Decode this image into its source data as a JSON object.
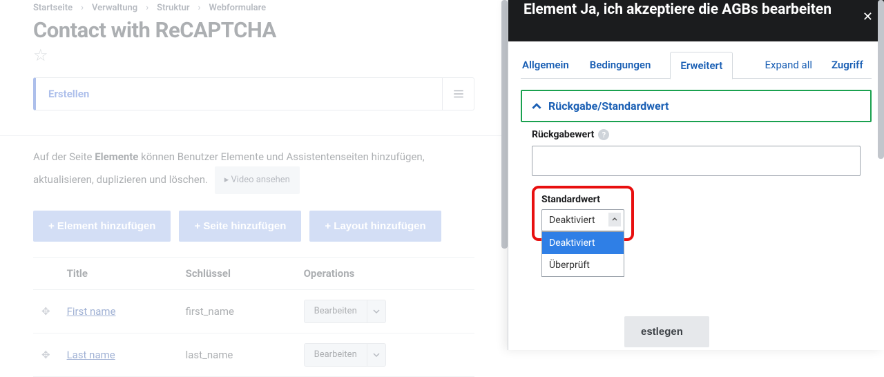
{
  "breadcrumb": {
    "items": [
      "Startseite",
      "Verwaltung",
      "Struktur",
      "Webformulare"
    ]
  },
  "page": {
    "title": "Contact with ReCAPTCHA"
  },
  "local_tasks": {
    "create": "Erstellen"
  },
  "helper": {
    "pre": "Auf der Seite ",
    "bold": "Elemente",
    "post": " können Benutzer Elemente und Assistentenseiten hinzufügen, aktualisieren, duplizieren und löschen.",
    "video_btn": "▸ Video ansehen"
  },
  "add_buttons": {
    "element": "+ Element hinzufügen",
    "page": "+ Seite hinzufügen",
    "layout": "+ Layout hinzufügen"
  },
  "table": {
    "headers": {
      "title": "Title",
      "key": "Schlüssel",
      "ops": "Operations"
    },
    "rows": [
      {
        "title": "First name",
        "key": "first_name",
        "op": "Bearbeiten"
      },
      {
        "title": "Last name",
        "key": "last_name",
        "op": "Bearbeiten"
      }
    ]
  },
  "modal": {
    "title": "Element Ja, ich akzeptiere die AGBs bearbeiten",
    "tabs": {
      "general": "Allgemein",
      "conditions": "Bedingungen",
      "advanced": "Erweitert",
      "access": "Zugriff"
    },
    "expand_all": "Expand all",
    "fieldset_title": "Rückgabe/Standardwert",
    "return_label": "Rückgabewert",
    "default_label": "Standardwert",
    "select": {
      "selected": "Deaktiviert",
      "options": [
        "Deaktiviert",
        "Überprüft"
      ]
    },
    "set_btn_suffix": "estlegen"
  }
}
